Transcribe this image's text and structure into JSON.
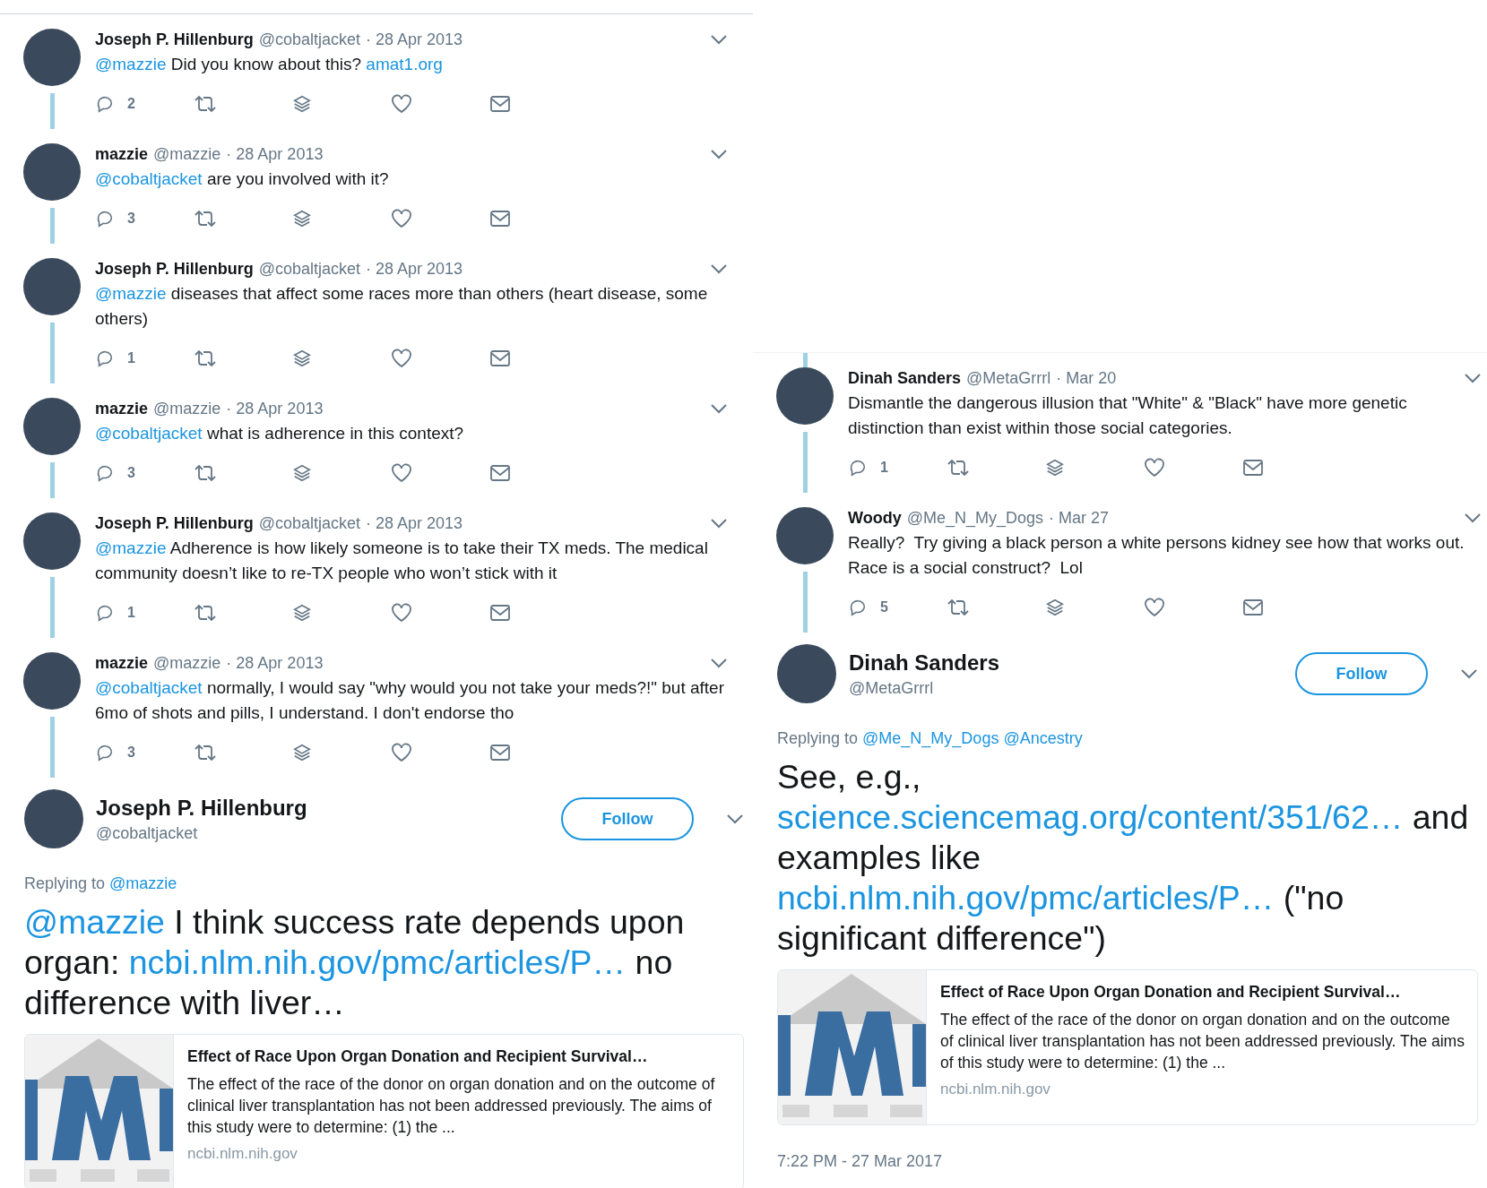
{
  "panels": [
    {
      "thread_above": false,
      "thread": [
        {
          "name": "Joseph P. Hillenburg",
          "handle": "@cobaltjacket",
          "date": "· 28 Apr 2013",
          "segments": [
            {
              "kind": "mention",
              "text": "@mazzie"
            },
            {
              "kind": "text",
              "text": " Did you know about this? "
            },
            {
              "kind": "link",
              "text": "amat1.org"
            }
          ],
          "replies": "2"
        },
        {
          "name": "mazzie",
          "handle": "@mazzie",
          "date": "· 28 Apr 2013",
          "segments": [
            {
              "kind": "mention",
              "text": "@cobaltjacket"
            },
            {
              "kind": "text",
              "text": " are you involved with it?"
            }
          ],
          "replies": "3"
        },
        {
          "name": "Joseph P. Hillenburg",
          "handle": "@cobaltjacket",
          "date": "· 28 Apr 2013",
          "segments": [
            {
              "kind": "mention",
              "text": "@mazzie"
            },
            {
              "kind": "text",
              "text": " diseases that affect some races more than others (heart disease, some others)"
            }
          ],
          "replies": "1"
        },
        {
          "name": "mazzie",
          "handle": "@mazzie",
          "date": "· 28 Apr 2013",
          "segments": [
            {
              "kind": "mention",
              "text": "@cobaltjacket"
            },
            {
              "kind": "text",
              "text": " what is adherence in this context?"
            }
          ],
          "replies": "3"
        },
        {
          "name": "Joseph P. Hillenburg",
          "handle": "@cobaltjacket",
          "date": "· 28 Apr 2013",
          "segments": [
            {
              "kind": "mention",
              "text": "@mazzie"
            },
            {
              "kind": "text",
              "text": " Adherence is how likely someone is to take their TX meds. The medical community doesn’t like to re-TX people who won’t stick with it"
            }
          ],
          "replies": "1"
        },
        {
          "name": "mazzie",
          "handle": "@mazzie",
          "date": "· 28 Apr 2013",
          "segments": [
            {
              "kind": "mention",
              "text": "@cobaltjacket"
            },
            {
              "kind": "text",
              "text": " normally, I would say \"why would you not take your meds?!\" but after 6mo of shots and pills, I understand. I don't endorse tho"
            }
          ],
          "replies": "3"
        }
      ],
      "main": {
        "name": "Joseph P. Hillenburg",
        "handle": "@cobaltjacket",
        "follow": "Follow",
        "replying_label": "Replying to",
        "replying_to": [
          "@mazzie"
        ],
        "segments": [
          {
            "kind": "mention",
            "text": "@mazzie"
          },
          {
            "kind": "text",
            "text": " I think success rate depends upon organ: "
          },
          {
            "kind": "link",
            "text": "ncbi.nlm.nih.gov/pmc/articles/P…"
          },
          {
            "kind": "text",
            "text": " no difference with liver…"
          }
        ],
        "card": {
          "title": "Effect of Race Upon Organ Donation and Recipient Survival…",
          "description": "The effect of the race of the donor on organ donation and on the outcome of clinical liver transplantation has not been addressed previously. The aims of this study were to determine: (1) the ...",
          "domain": "ncbi.nlm.nih.gov"
        }
      }
    },
    {
      "thread_above": true,
      "thread": [
        {
          "name": "Dinah Sanders",
          "handle": "@MetaGrrrl",
          "date": "· Mar 20",
          "segments": [
            {
              "kind": "text",
              "text": "Dismantle the dangerous illusion that \"White\" & \"Black\" have more genetic distinction than exist within those social categories."
            }
          ],
          "replies": "1"
        },
        {
          "name": "Woody",
          "handle": "@Me_N_My_Dogs",
          "date": "· Mar 27",
          "segments": [
            {
              "kind": "text",
              "text": "Really?  Try giving a black person a white persons kidney see how that works out. Race is a social construct?  Lol"
            }
          ],
          "replies": "5"
        }
      ],
      "main": {
        "name": "Dinah Sanders",
        "handle": "@MetaGrrrl",
        "follow": "Follow",
        "replying_label": "Replying to",
        "replying_to": [
          "@Me_N_My_Dogs",
          "@Ancestry"
        ],
        "segments": [
          {
            "kind": "text",
            "text": "See, e.g., "
          },
          {
            "kind": "link",
            "text": "science.sciencemag.org/content/351/62…"
          },
          {
            "kind": "text",
            "text": " and examples like "
          },
          {
            "kind": "link",
            "text": "ncbi.nlm.nih.gov/pmc/articles/P…"
          },
          {
            "kind": "text",
            "text": " (\"no significant difference\")"
          }
        ],
        "card": {
          "title": "Effect of Race Upon Organ Donation and Recipient Survival…",
          "description": "The effect of the race of the donor on organ donation and on the outcome of clinical liver transplantation has not been addressed previously. The aims of this study were to determine: (1) the ...",
          "domain": "ncbi.nlm.nih.gov"
        },
        "timestamp": "7:22 PM - 27 Mar 2017"
      }
    }
  ]
}
